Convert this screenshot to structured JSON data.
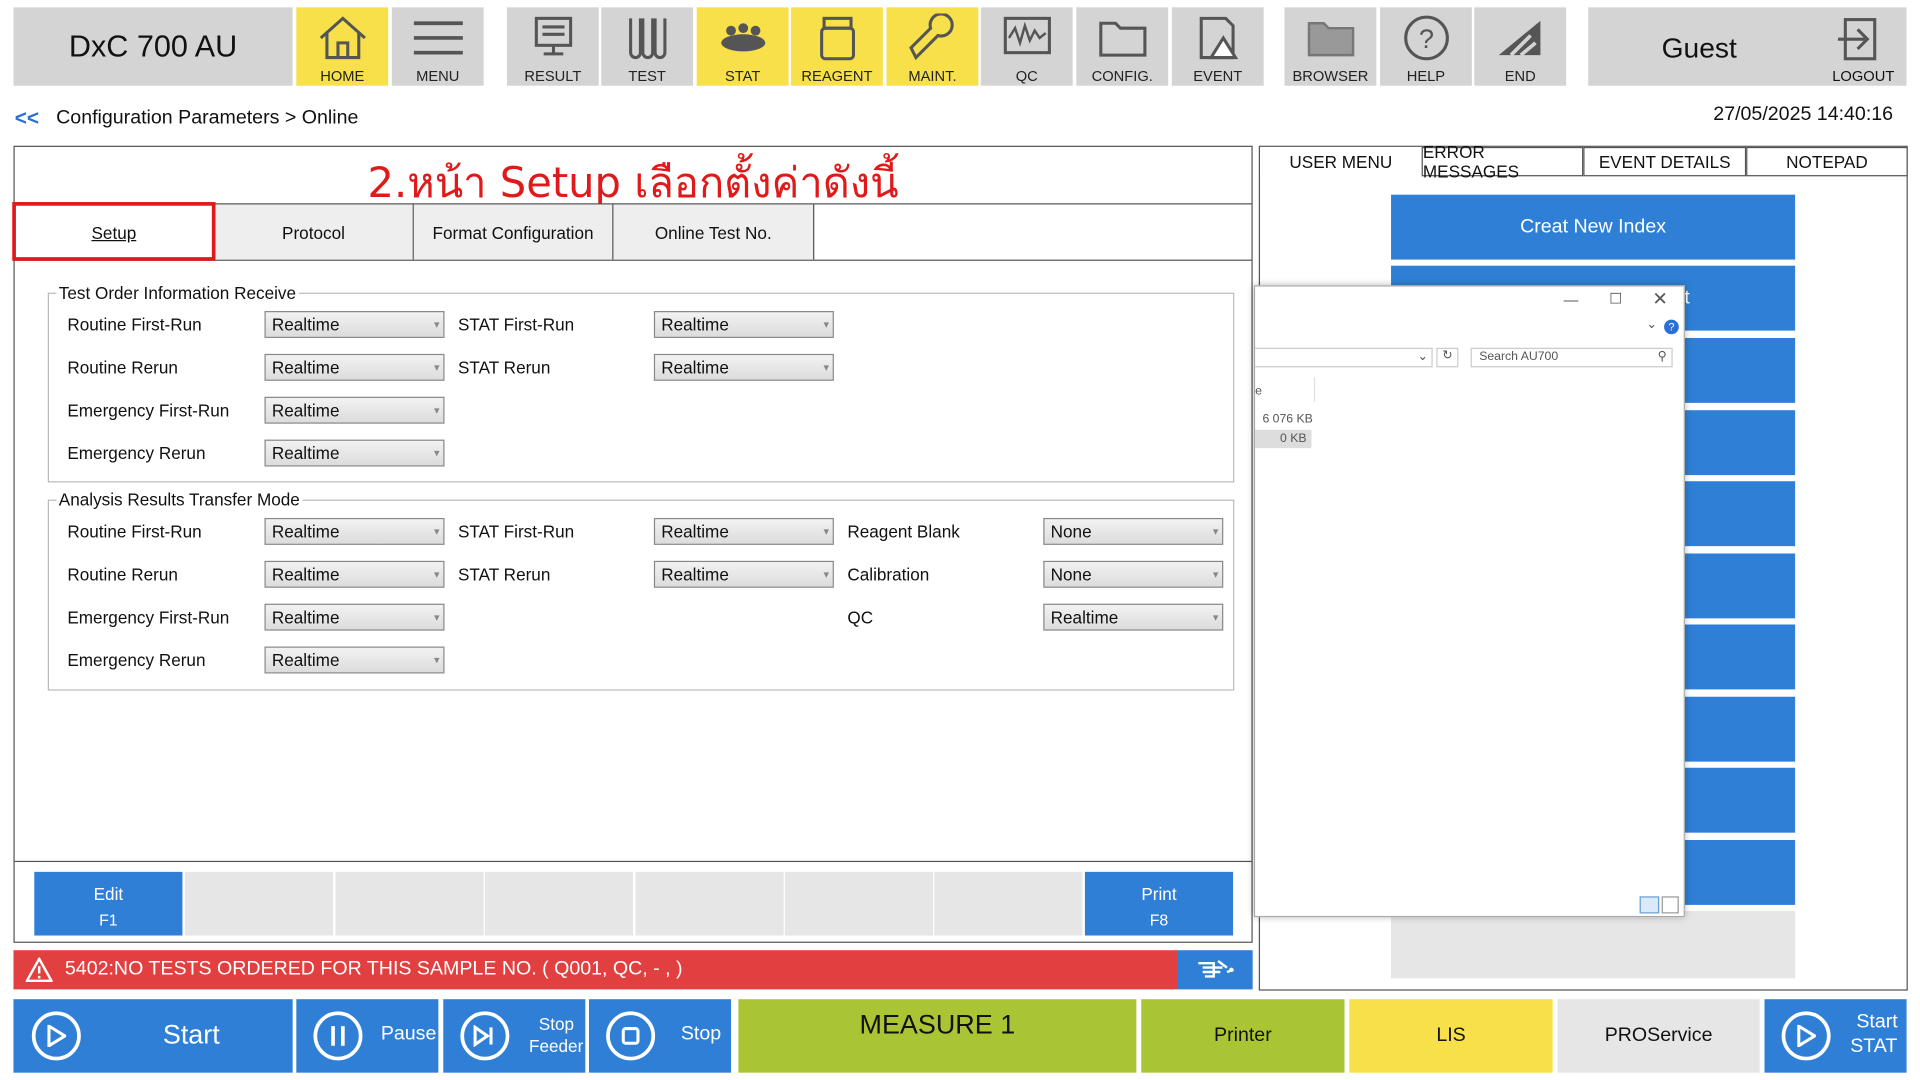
{
  "app": {
    "title": "DxC 700 AU",
    "user": "Guest",
    "logout_label": "LOGOUT",
    "datetime": "27/05/2025 14:40:16"
  },
  "toolbar": [
    {
      "label": "HOME",
      "icon": "home-icon",
      "highlight": true
    },
    {
      "label": "MENU",
      "icon": "menu-icon",
      "highlight": false
    },
    {
      "label": "RESULT",
      "icon": "result-icon",
      "highlight": false
    },
    {
      "label": "TEST",
      "icon": "test-tubes-icon",
      "highlight": false
    },
    {
      "label": "STAT",
      "icon": "stat-icon",
      "highlight": true
    },
    {
      "label": "REAGENT",
      "icon": "reagent-icon",
      "highlight": true
    },
    {
      "label": "MAINT.",
      "icon": "wrench-icon",
      "highlight": true
    },
    {
      "label": "QC",
      "icon": "qc-chart-icon",
      "highlight": false
    },
    {
      "label": "CONFIG.",
      "icon": "folder-icon",
      "highlight": false
    },
    {
      "label": "EVENT",
      "icon": "event-icon",
      "highlight": false
    },
    {
      "label": "BROWSER",
      "icon": "browser-folder-icon",
      "highlight": false
    },
    {
      "label": "HELP",
      "icon": "help-icon",
      "highlight": false
    },
    {
      "label": "END",
      "icon": "end-icon",
      "highlight": false
    }
  ],
  "breadcrumb": {
    "back": "<<",
    "path": "Configuration Parameters > Online"
  },
  "annotation": "2.หน้า Setup เลือกตั้งค่าดังนี้",
  "tabs": [
    "Setup",
    "Protocol",
    "Format Configuration",
    "Online Test No."
  ],
  "order_info": {
    "legend": "Test Order Information Receive",
    "rows": [
      {
        "label": "Routine First-Run",
        "value": "Realtime",
        "stat_label": "STAT First-Run",
        "stat_value": "Realtime"
      },
      {
        "label": "Routine Rerun",
        "value": "Realtime",
        "stat_label": "STAT Rerun",
        "stat_value": "Realtime"
      },
      {
        "label": "Emergency First-Run",
        "value": "Realtime"
      },
      {
        "label": "Emergency Rerun",
        "value": "Realtime"
      }
    ]
  },
  "transfer": {
    "legend": "Analysis Results Transfer Mode",
    "rows": [
      {
        "label": "Routine First-Run",
        "value": "Realtime",
        "stat_label": "STAT First-Run",
        "stat_value": "Realtime",
        "extra_label": "Reagent Blank",
        "extra_value": "None"
      },
      {
        "label": "Routine Rerun",
        "value": "Realtime",
        "stat_label": "STAT Rerun",
        "stat_value": "Realtime",
        "extra_label": "Calibration",
        "extra_value": "None"
      },
      {
        "label": "Emergency First-Run",
        "value": "Realtime",
        "extra_label": "QC",
        "extra_value": "Realtime"
      },
      {
        "label": "Emergency Rerun",
        "value": "Realtime"
      }
    ]
  },
  "fkeys": {
    "edit": "Edit",
    "edit_key": "F1",
    "print": "Print",
    "print_key": "F8"
  },
  "error": "5402:NO TESTS ORDERED FOR THIS SAMPLE NO. (  Q001,        QC,      - , )",
  "right_tabs": [
    "USER MENU",
    "ERROR MESSAGES",
    "EVENT DETAILS",
    "NOTEPAD"
  ],
  "right_buttons": {
    "first": "Creat New Index",
    "second_tail": "t"
  },
  "explorer": {
    "search_placeholder": "Search AU700",
    "col_tail": "e",
    "size1": "6 076 KB",
    "size2": "0 KB"
  },
  "bottom": {
    "start": "Start",
    "pause": "Pause",
    "stop_feeder_1": "Stop",
    "stop_feeder_2": "Feeder",
    "stop": "Stop",
    "measure": "MEASURE 1",
    "printer": "Printer",
    "lis": "LIS",
    "proservice": "PROService",
    "start_stat_1": "Start",
    "start_stat_2": "STAT"
  },
  "colors": {
    "blue": "#2f7fd6",
    "yellow": "#f7e04a",
    "green": "#a9c534",
    "error": "#e24040",
    "annotation": "#e01a1a"
  }
}
